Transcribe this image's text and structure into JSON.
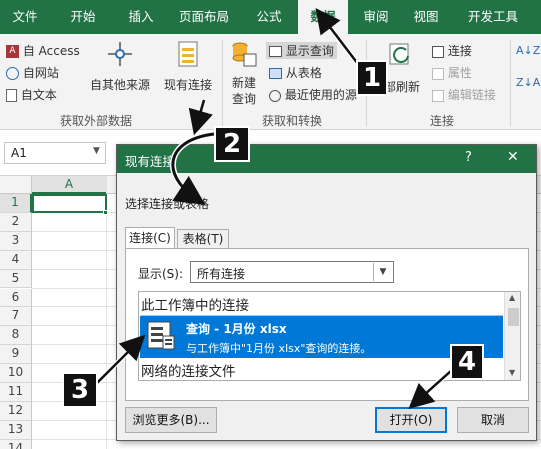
{
  "tabs": [
    "文件",
    "开始",
    "插入",
    "页面布局",
    "公式",
    "数据",
    "审阅",
    "视图",
    "开发工具"
  ],
  "ribbon": {
    "from_access": "自 Access",
    "from_web": "自网站",
    "from_text": "自文本",
    "from_other_line1": "自其他来源",
    "existing_conn": "现有连接",
    "new_query_line1": "新建",
    "new_query_line2": "查询",
    "show_query": "显示查询",
    "from_table": "从表格",
    "recent_sources": "最近使用的源",
    "refresh_all": "部刷新",
    "connections": "连接",
    "properties": "属性",
    "edit_links": "编辑链接",
    "group_external": "获取外部数据",
    "group_transform": "获取和转换",
    "group_connections": "连接",
    "sort_az": "A↓Z",
    "sort_za": "Z↓A"
  },
  "formula_bar": {
    "name_box": "A1"
  },
  "grid": {
    "column_a": "A",
    "rows": [
      "1",
      "2",
      "3",
      "4",
      "5",
      "6",
      "7",
      "8",
      "9",
      "10",
      "11",
      "12",
      "13",
      "14"
    ]
  },
  "dialog": {
    "title": "现有连接",
    "help": "?",
    "close": "✕",
    "prompt": "选择连接或表格",
    "tab_connections": "连接(C)",
    "tab_tables": "表格(T)",
    "show_label": "显示(S):",
    "show_value": "所有连接",
    "section_workbook": "此工作簿中的连接",
    "item_name": "查询 - 1月份 xlsx",
    "item_desc": "与工作簿中\"1月份 xlsx\"查询的连接。",
    "section_network": "网络的连接文件",
    "browse_button": "浏览更多(B)...",
    "open_button": "打开(O)",
    "cancel_button": "取消"
  },
  "callouts": [
    "1",
    "2",
    "3",
    "4"
  ],
  "colors": {
    "accent": "#217346",
    "selection": "#0078d7",
    "callout": "#111111"
  }
}
